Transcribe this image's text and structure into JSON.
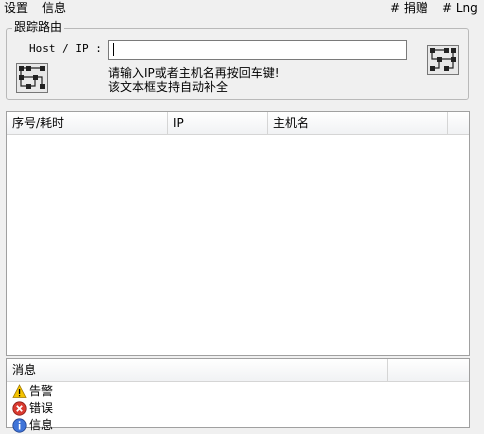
{
  "menu": {
    "settings": "设置",
    "info": "信息",
    "donate": "# 捐赠",
    "lng": "# Lng"
  },
  "traceroute": {
    "group_title": "跟踪路由",
    "host_label": "Host / IP :",
    "host_value": "",
    "hint_line1": "请输入IP或者主机名再按回车键!",
    "hint_line2": "该文本框支持自动补全",
    "left_icon": "route-icon",
    "right_icon": "route-icon"
  },
  "table": {
    "columns": [
      "序号/耗时",
      "IP",
      "主机名"
    ]
  },
  "messages": {
    "header": "消息",
    "items": [
      {
        "icon": "warning-icon",
        "label": "告警"
      },
      {
        "icon": "error-icon",
        "label": "错误"
      },
      {
        "icon": "info-icon",
        "label": "信息"
      }
    ]
  },
  "colors": {
    "background": "#f0f0f0",
    "warning": "#f5c400",
    "error": "#d93a30",
    "info": "#3f74d8"
  }
}
